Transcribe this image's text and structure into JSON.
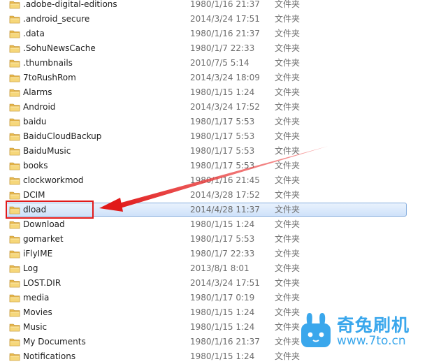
{
  "files": [
    {
      "name": ".adobe-digital-editions",
      "date": "1980/1/16 21:37",
      "type": "文件夹"
    },
    {
      "name": ".android_secure",
      "date": "2014/3/24 17:51",
      "type": "文件夹"
    },
    {
      "name": ".data",
      "date": "1980/1/16 21:37",
      "type": "文件夹"
    },
    {
      "name": ".SohuNewsCache",
      "date": "1980/1/7 22:33",
      "type": "文件夹"
    },
    {
      "name": ".thumbnails",
      "date": "2010/7/5 5:14",
      "type": "文件夹"
    },
    {
      "name": "7toRushRom",
      "date": "2014/3/24 18:09",
      "type": "文件夹"
    },
    {
      "name": "Alarms",
      "date": "1980/1/15 1:24",
      "type": "文件夹"
    },
    {
      "name": "Android",
      "date": "2014/3/24 17:52",
      "type": "文件夹"
    },
    {
      "name": "baidu",
      "date": "1980/1/17 5:53",
      "type": "文件夹"
    },
    {
      "name": "BaiduCloudBackup",
      "date": "1980/1/17 5:53",
      "type": "文件夹"
    },
    {
      "name": "BaiduMusic",
      "date": "1980/1/17 5:53",
      "type": "文件夹"
    },
    {
      "name": "books",
      "date": "1980/1/17 5:53",
      "type": "文件夹"
    },
    {
      "name": "clockworkmod",
      "date": "1980/1/16 21:45",
      "type": "文件夹"
    },
    {
      "name": "DCIM",
      "date": "2014/3/28 17:52",
      "type": "文件夹"
    },
    {
      "name": "dload",
      "date": "2014/4/28 11:37",
      "type": "文件夹",
      "selected": true
    },
    {
      "name": "Download",
      "date": "1980/1/15 1:24",
      "type": "文件夹"
    },
    {
      "name": "gomarket",
      "date": "1980/1/17 5:53",
      "type": "文件夹"
    },
    {
      "name": "iFlyIME",
      "date": "1980/1/7 22:33",
      "type": "文件夹"
    },
    {
      "name": "Log",
      "date": "2013/8/1 8:01",
      "type": "文件夹"
    },
    {
      "name": "LOST.DIR",
      "date": "2014/3/24 17:51",
      "type": "文件夹"
    },
    {
      "name": "media",
      "date": "1980/1/17 0:19",
      "type": "文件夹"
    },
    {
      "name": "Movies",
      "date": "1980/1/15 1:24",
      "type": "文件夹"
    },
    {
      "name": "Music",
      "date": "1980/1/15 1:24",
      "type": "文件夹"
    },
    {
      "name": "My Documents",
      "date": "1980/1/16 21:37",
      "type": "文件夹"
    },
    {
      "name": "Notifications",
      "date": "1980/1/15 1:24",
      "type": "文件夹"
    }
  ],
  "watermark": {
    "title": "奇兔刷机",
    "url": "www.7to.cn",
    "color": "#3aa7ec"
  },
  "annotation": {
    "highlight_color": "#e11a1a",
    "icon": "arrow-icon"
  },
  "folder_icon": "folder-icon",
  "selection_color": "#cfe2fa"
}
